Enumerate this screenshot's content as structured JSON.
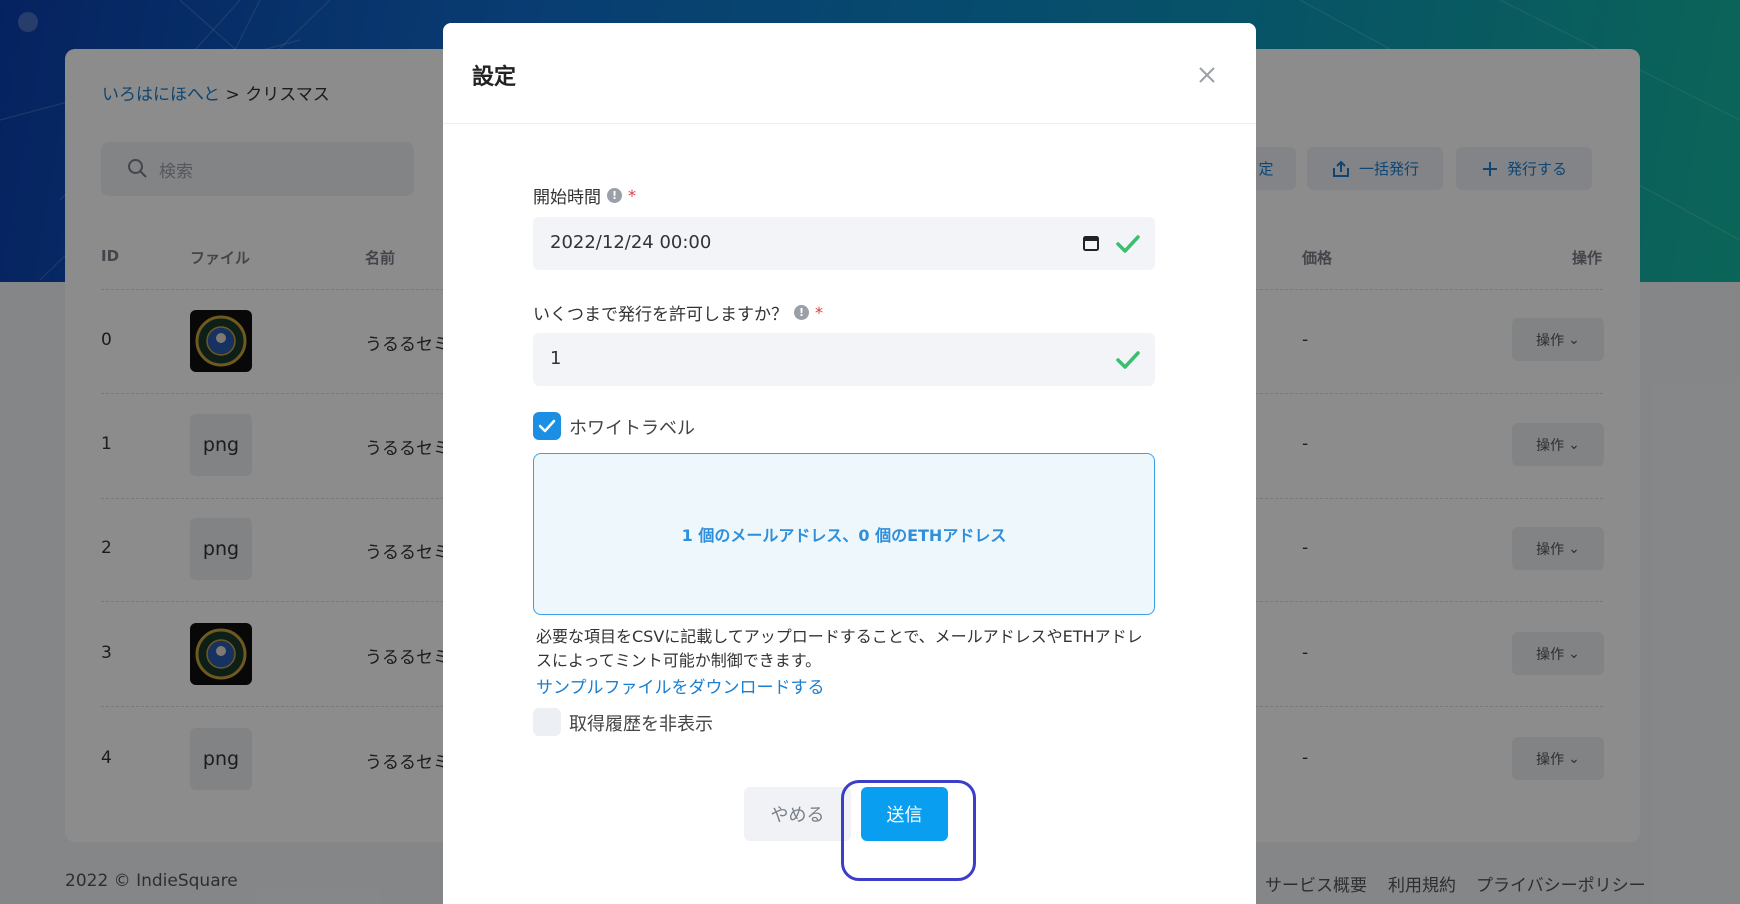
{
  "breadcrumb": {
    "parent": "いろはにほへと",
    "separator": " > ",
    "current": "クリスマス"
  },
  "search": {
    "placeholder": "検索"
  },
  "toolbar": {
    "settings_label": "定",
    "bulk_issue_label": "一括発行",
    "issue_label": "発行する"
  },
  "table": {
    "headers": {
      "id": "ID",
      "file": "ファイル",
      "name": "名前",
      "price": "価格",
      "actions": "操作"
    },
    "rows": [
      {
        "id": "0",
        "file": "",
        "name": "うるるセミ",
        "price": "-",
        "action": "操作"
      },
      {
        "id": "1",
        "file": "png",
        "name": "うるるセミ",
        "price": "-",
        "action": "操作"
      },
      {
        "id": "2",
        "file": "png",
        "name": "うるるセミ",
        "price": "-",
        "action": "操作"
      },
      {
        "id": "3",
        "file": "",
        "name": "うるるセミ",
        "price": "-",
        "action": "操作"
      },
      {
        "id": "4",
        "file": "png",
        "name": "うるるセミ",
        "price": "-",
        "action": "操作"
      }
    ]
  },
  "footer": {
    "copyright": "2022 ©  IndieSquare",
    "links": [
      "サービス概要",
      "利用規約",
      "プライバシーポリシー"
    ]
  },
  "modal": {
    "title": "設定",
    "start_time": {
      "label": "開始時間",
      "required": "*",
      "value": "2022/12/24 00:00"
    },
    "max_issue": {
      "label": "いくつまで発行を許可しますか？",
      "required": "*",
      "value": "1"
    },
    "whitelabel": {
      "label": "ホワイトラベル",
      "checked": true
    },
    "dropzone_text": "1 個のメールアドレス、0 個のETHアドレス",
    "help_text": "必要な項目をCSVに記載してアップロードすることで、メールアドレスやETHアドレスによってミント可能か制御できます。",
    "sample_link": "サンプルファイルをダウンロードする",
    "hide_history": {
      "label": "取得履歴を非表示",
      "checked": false
    },
    "cancel_label": "やめる",
    "submit_label": "送信"
  },
  "colors": {
    "accent": "#0a9ef0",
    "link": "#1a7fd0",
    "success": "#3bbf6e",
    "highlight_border": "#3c3ec8"
  }
}
